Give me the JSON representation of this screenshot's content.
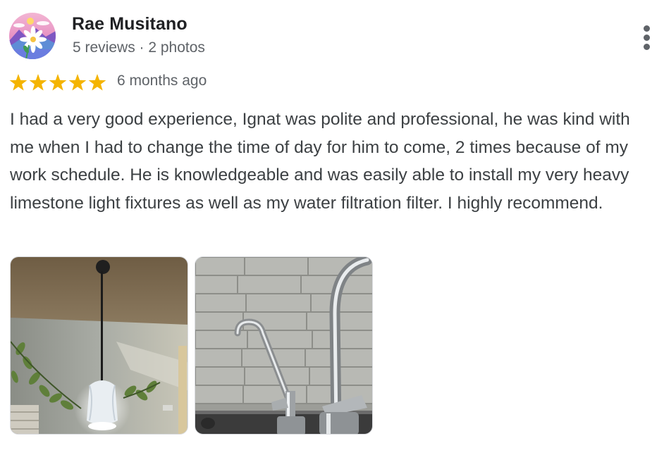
{
  "review": {
    "author": "Rae Musitano",
    "author_meta": "5 reviews · 2 photos",
    "rating": 5,
    "rating_max": 5,
    "time_ago": "6 months ago",
    "text": "I had a very good experience, Ignat was polite and professional, he was kind with me when I had to change the time of day for him to come, 2 times because of my work schedule. He is knowledgeable and was easily able to install my very heavy limestone light fixtures as well as my water filtration filter. I highly recommend.",
    "photos": [
      {
        "subject": "pendant-light"
      },
      {
        "subject": "faucets"
      }
    ]
  },
  "colors": {
    "star": "#f4b400",
    "name_text": "#202124",
    "secondary_text": "#5f6368",
    "body_text": "#3c4043"
  },
  "icons": {
    "more": "more-vert-icon",
    "star": "star-icon"
  }
}
